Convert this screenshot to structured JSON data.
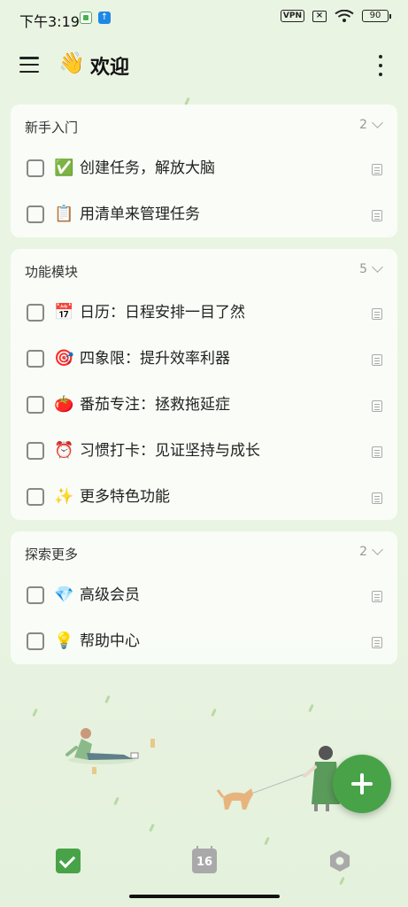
{
  "status_bar": {
    "time": "下午3:19",
    "vpn": "VPN",
    "battery": "90"
  },
  "header": {
    "emoji": "👋",
    "title": "欢迎"
  },
  "sections": [
    {
      "title": "新手入门",
      "count": "2",
      "tasks": [
        {
          "emoji": "✅",
          "label": "创建任务，解放大脑"
        },
        {
          "emoji": "📋",
          "label": "用清单来管理任务"
        }
      ]
    },
    {
      "title": "功能模块",
      "count": "5",
      "tasks": [
        {
          "emoji": "📅",
          "label": "日历：日程安排一目了然"
        },
        {
          "emoji": "🎯",
          "label": "四象限：提升效率利器"
        },
        {
          "emoji": "🍅",
          "label": "番茄专注：拯救拖延症"
        },
        {
          "emoji": "⏰",
          "label": "习惯打卡：见证坚持与成长"
        },
        {
          "emoji": "✨",
          "label": "更多特色功能"
        }
      ]
    },
    {
      "title": "探索更多",
      "count": "2",
      "tasks": [
        {
          "emoji": "💎",
          "label": "高级会员"
        },
        {
          "emoji": "💡",
          "label": "帮助中心"
        }
      ]
    }
  ],
  "bottom_nav": {
    "calendar_day": "16"
  },
  "colors": {
    "accent": "#48a348",
    "background": "#e8f3e1"
  }
}
